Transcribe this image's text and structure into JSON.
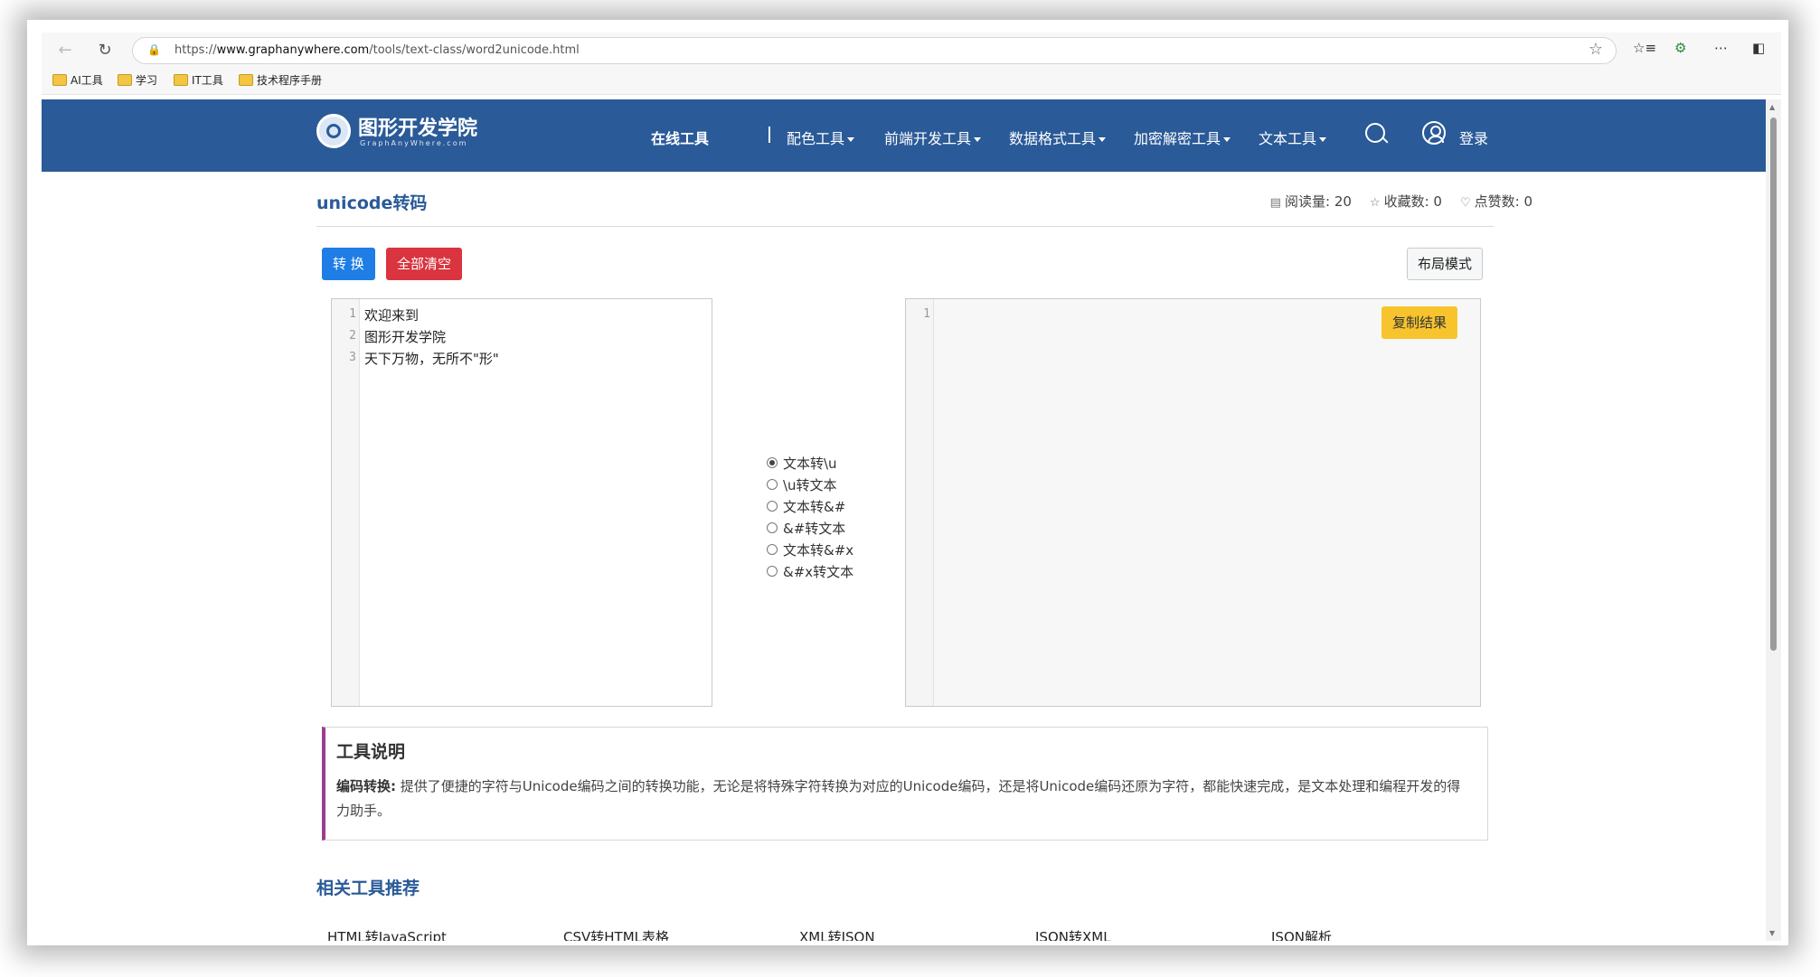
{
  "browser": {
    "url_prefix": "https://",
    "url_domain": "www.graphanywhere.com",
    "url_path": "/tools/text-class/word2unicode.html",
    "bookmarks": [
      "AI工具",
      "学习",
      "IT工具",
      "技术程序手册"
    ]
  },
  "site": {
    "logo_text": "图形开发学院",
    "logo_sub": "GraphAnyWhere.com",
    "nav": [
      "在线工具",
      "配色工具",
      "前端开发工具",
      "数据格式工具",
      "加密解密工具",
      "文本工具"
    ],
    "login": "登录"
  },
  "page": {
    "title": "unicode转码",
    "stats": {
      "reads_label": "阅读量:",
      "reads": "20",
      "favorites_label": "收藏数:",
      "favorites": "0",
      "likes_label": "点赞数:",
      "likes": "0"
    },
    "buttons": {
      "convert": "转 换",
      "clear": "全部清空",
      "layout": "布局模式",
      "copy": "复制结果"
    },
    "input_lines": [
      "欢迎来到",
      "图形开发学院",
      "天下万物，无所不\"形\""
    ],
    "input_line_numbers": [
      "1",
      "2",
      "3"
    ],
    "output_line_numbers": [
      "1"
    ],
    "modes": [
      "文本转\\u",
      "\\u转文本",
      "文本转&#",
      "&#转文本",
      "文本转&#x",
      "&#x转文本"
    ],
    "selected_mode": "文本转\\u",
    "description": {
      "heading": "工具说明",
      "label": "编码转换:",
      "text": "提供了便捷的字符与Unicode编码之间的转换功能，无论是将特殊字符转换为对应的Unicode编码，还是将Unicode编码还原为字符，都能快速完成，是文本处理和编程开发的得力助手。"
    },
    "related_title": "相关工具推荐",
    "related": [
      "HTML转JavaScript",
      "CSV转HTML表格",
      "XML转JSON",
      "JSON转XML",
      "JSON解析"
    ]
  }
}
